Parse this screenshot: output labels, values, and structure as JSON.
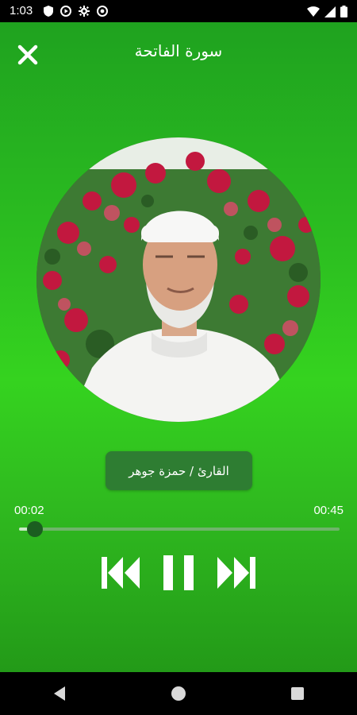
{
  "status_bar": {
    "time": "1:03",
    "icons_left": [
      "shield-icon",
      "play-circle-icon",
      "gear-icon",
      "sync-icon"
    ],
    "icons_right": [
      "wifi-icon",
      "signal-icon",
      "battery-icon"
    ]
  },
  "header": {
    "title": "سورة الفاتحة",
    "close_icon": "close-icon"
  },
  "artwork": {
    "description_icon": "reciter-photo"
  },
  "reciter": {
    "label": "القارئ / حمزة جوهر"
  },
  "progress": {
    "elapsed": "00:02",
    "total": "00:45",
    "fraction": 0.05
  },
  "controls": {
    "previous_icon": "skip-previous-icon",
    "pause_icon": "pause-icon",
    "next_icon": "skip-next-icon"
  },
  "navigation": {
    "back_icon": "back-icon",
    "home_icon": "home-icon",
    "recents_icon": "recents-icon"
  },
  "colors": {
    "background_green": "#2cbf20",
    "badge_green": "#2e7d32",
    "thumb_green": "#1b5e20"
  }
}
